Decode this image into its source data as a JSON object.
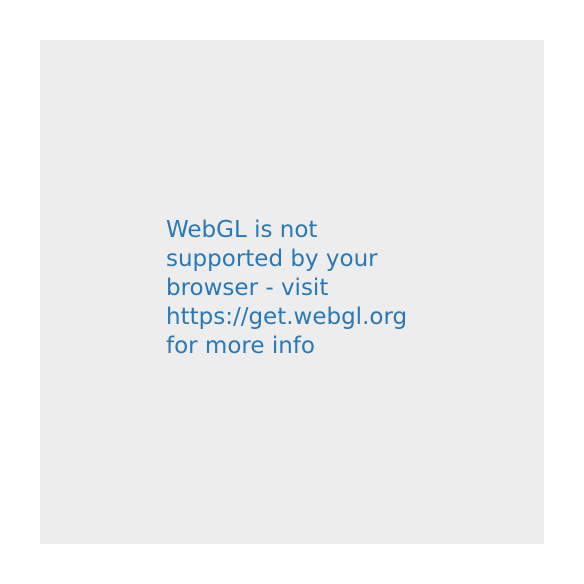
{
  "webgl_notice": {
    "lines": [
      "WebGL is not",
      "supported by your",
      "browser - visit",
      "https://get.webgl.org",
      "for more info"
    ],
    "text_color": "#2a78b5",
    "background_color": "#ededed"
  }
}
